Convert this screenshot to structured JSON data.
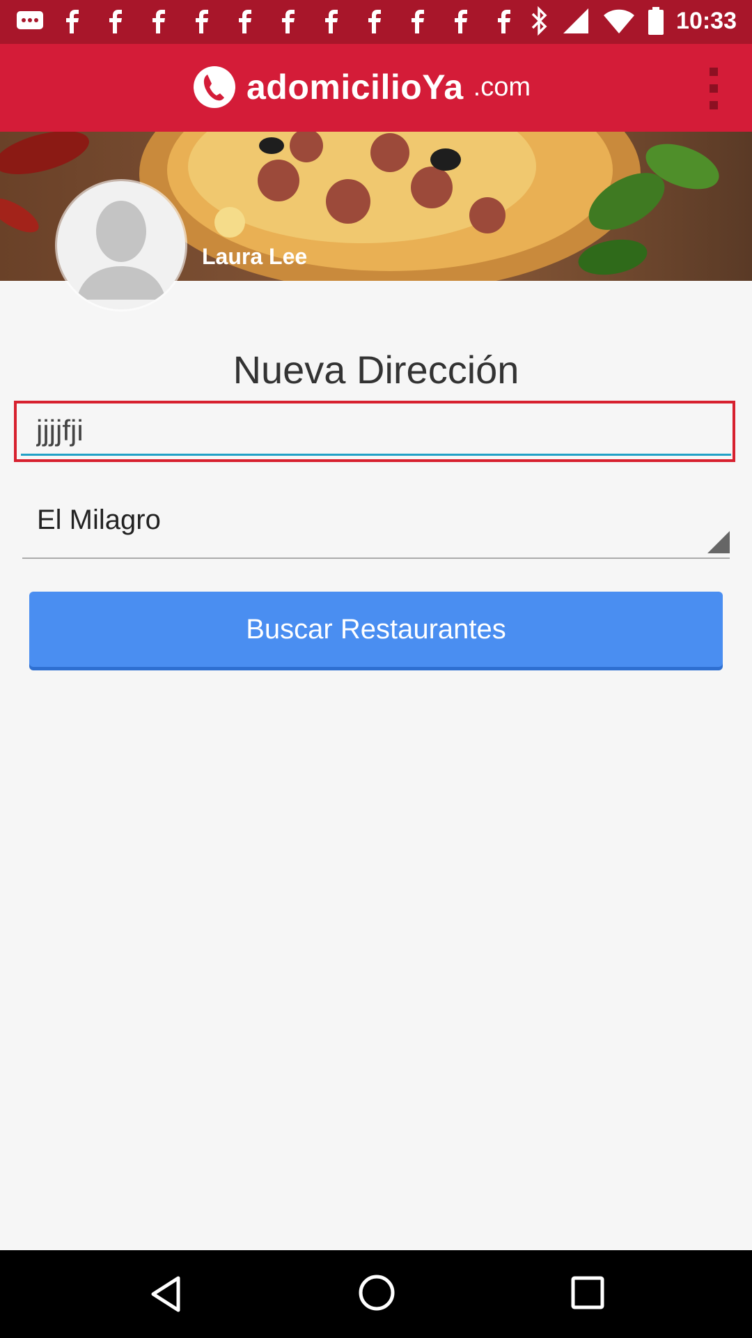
{
  "status_bar": {
    "time": "10:33",
    "notification_icons": [
      "message-icon",
      "facebook-icon",
      "facebook-icon",
      "facebook-icon",
      "facebook-icon",
      "facebook-icon",
      "facebook-icon",
      "facebook-icon",
      "facebook-icon",
      "facebook-icon",
      "facebook-icon",
      "facebook-icon"
    ],
    "system_icons": [
      "bluetooth-icon",
      "signal-icon",
      "wifi-icon",
      "battery-icon"
    ]
  },
  "app_bar": {
    "logo_text": "adomicilioYa",
    "logo_tld": ".com",
    "menu_icon": "more-vert-icon"
  },
  "profile": {
    "name": "Laura Lee"
  },
  "form": {
    "title": "Nueva Dirección",
    "address_value": "jjjjfji",
    "city_value": "El Milagro",
    "search_button_label": "Buscar Restaurantes"
  },
  "colors": {
    "status_bar": "#a8162a",
    "app_bar": "#d41c38",
    "button": "#4a8ef1",
    "input_underline": "#21a1c6",
    "highlight": "#d7212f"
  },
  "nav_bar": {
    "icons": [
      "back-icon",
      "home-icon",
      "recent-apps-icon"
    ]
  }
}
